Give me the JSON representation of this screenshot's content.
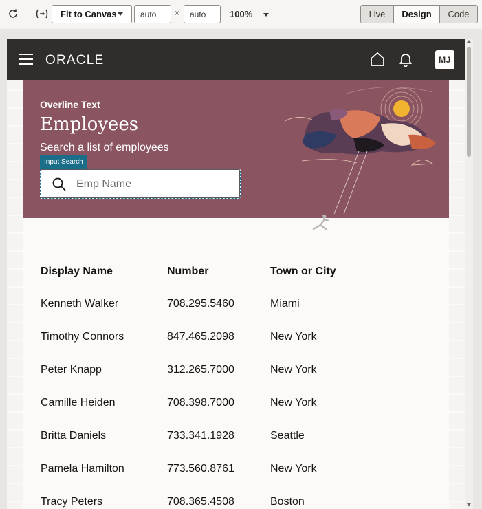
{
  "toolbar": {
    "fit_option": "Fit to Canvas",
    "width_value": "auto",
    "height_value": "auto",
    "times_symbol": "×",
    "zoom": "100%",
    "modes": [
      "Live",
      "Design",
      "Code"
    ],
    "active_mode": "Design",
    "icons": {
      "refresh": "refresh-icon",
      "expression": "expression-icon"
    }
  },
  "app_header": {
    "brand": "ORACLE",
    "avatar_initials": "MJ",
    "icons": {
      "menu": "hamburger-menu-icon",
      "home": "home-icon",
      "notifications": "bell-icon"
    }
  },
  "hero": {
    "overline": "Overline Text",
    "title": "Employees",
    "subtitle": "Search a list of employees",
    "input_label": "Input Search",
    "search_placeholder": "Emp Name"
  },
  "table": {
    "columns": [
      "Display Name",
      "Number",
      "Town or City"
    ],
    "rows": [
      [
        "Kenneth Walker",
        "708.295.5460",
        "Miami"
      ],
      [
        "Timothy Connors",
        "847.465.2098",
        "New York"
      ],
      [
        "Peter Knapp",
        "312.265.7000",
        "New York"
      ],
      [
        "Camille Heiden",
        "708.398.7000",
        "New York"
      ],
      [
        "Britta Daniels",
        "733.341.1928",
        "Seattle"
      ],
      [
        "Pamela Hamilton",
        "773.560.8761",
        "New York"
      ],
      [
        "Tracy Peters",
        "708.365.4508",
        "Boston"
      ]
    ]
  },
  "colors": {
    "header_bg": "#312d2a",
    "hero_bg": "#8b5461",
    "badge_bg": "#1a6e8a",
    "page_bg": "#fbfaf9"
  }
}
